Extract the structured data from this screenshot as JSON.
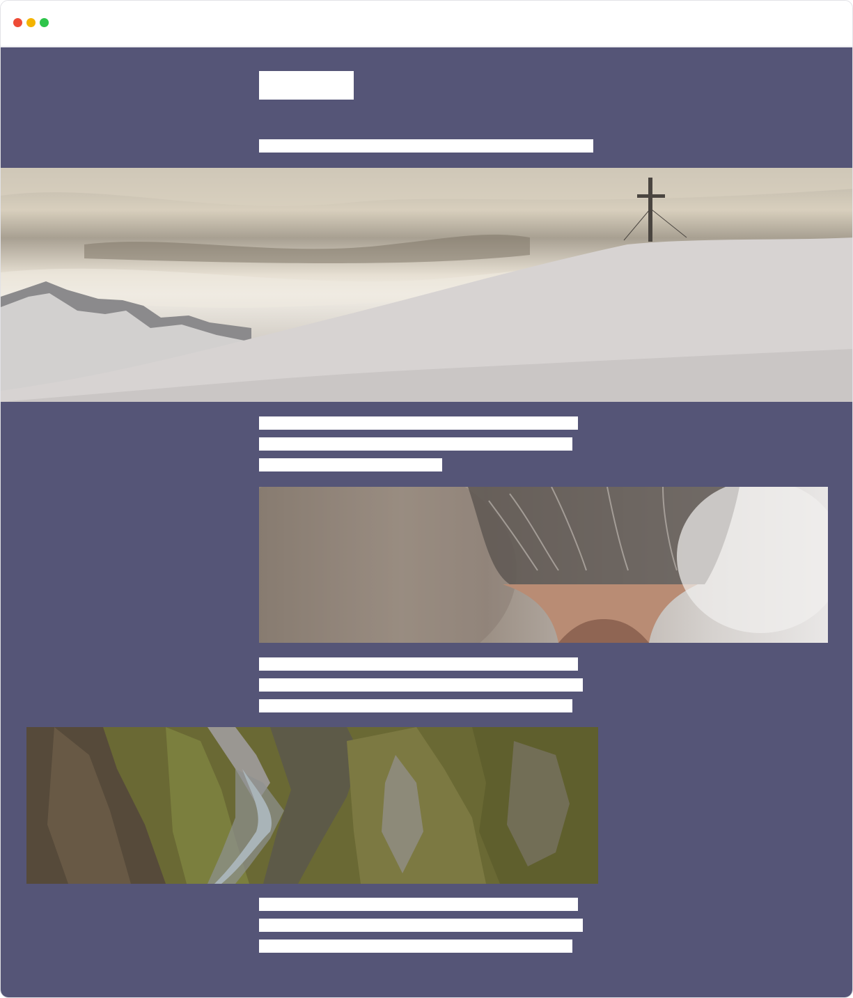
{
  "window": {
    "controls": [
      "close",
      "minimize",
      "maximize"
    ],
    "control_colors": {
      "close": "#ee4b36",
      "minimize": "#f4b400",
      "maximize": "#2ec44a"
    }
  },
  "page": {
    "background_color": "#555577",
    "placeholder_color": "#ffffff"
  },
  "images": [
    {
      "name": "mountain-summit-cross-image",
      "description_icon": "photo-icon"
    },
    {
      "name": "cat-nose-closeup-image",
      "description_icon": "photo-icon"
    },
    {
      "name": "mossy-canyon-image",
      "description_icon": "photo-icon"
    }
  ]
}
